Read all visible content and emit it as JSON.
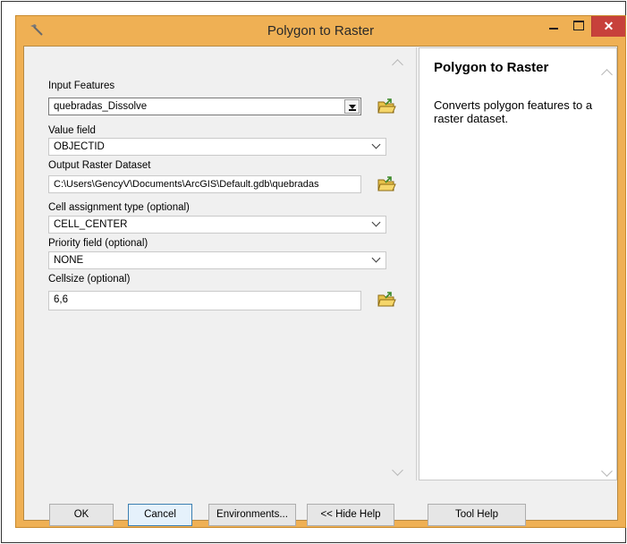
{
  "window": {
    "title": "Polygon to Raster",
    "close_glyph": "✕"
  },
  "form": {
    "input_features": {
      "label": "Input Features",
      "value": "quebradas_Dissolve"
    },
    "value_field": {
      "label": "Value field",
      "value": "OBJECTID"
    },
    "output_raster": {
      "label": "Output Raster Dataset",
      "value": "C:\\Users\\GencyV\\Documents\\ArcGIS\\Default.gdb\\quebradas"
    },
    "cell_assignment": {
      "label": "Cell assignment type (optional)",
      "value": "CELL_CENTER"
    },
    "priority_field": {
      "label": "Priority field (optional)",
      "value": "NONE"
    },
    "cellsize": {
      "label": "Cellsize (optional)",
      "value": "6,6"
    }
  },
  "help": {
    "title": "Polygon to Raster",
    "description": "Converts polygon features to a raster dataset."
  },
  "buttons": {
    "ok": "OK",
    "cancel": "Cancel",
    "environments": "Environments...",
    "hide_help": "<< Hide Help",
    "tool_help": "Tool Help"
  },
  "icons": {
    "app": "hammer-icon",
    "browse": "folder-open-icon"
  },
  "colors": {
    "title_bar": "#efb054",
    "close_button": "#c7413b",
    "focus_border": "#3c7fb1"
  }
}
